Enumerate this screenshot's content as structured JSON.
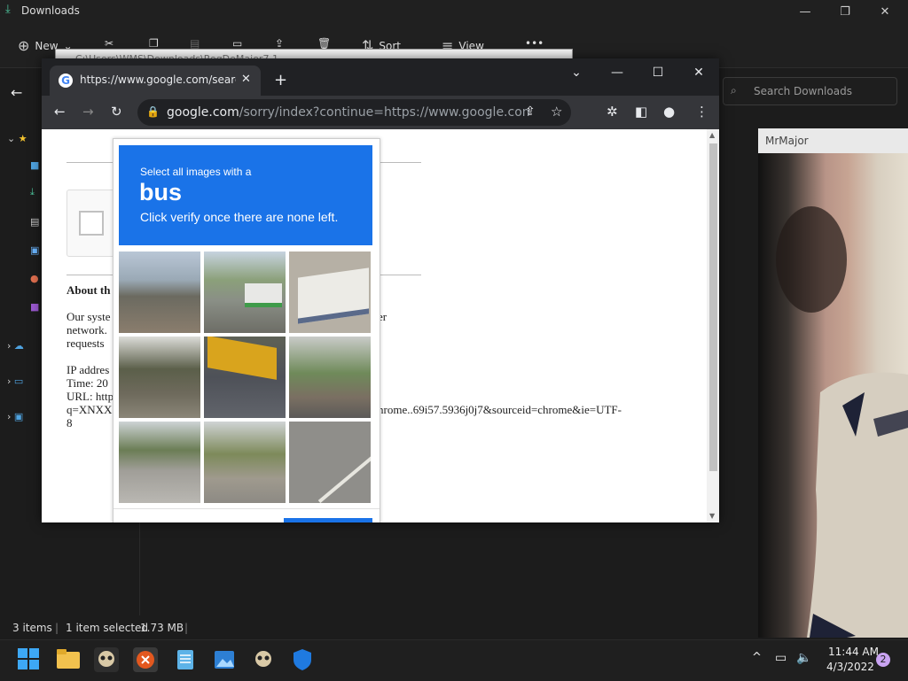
{
  "explorer": {
    "title": "Downloads",
    "toolbar": {
      "new_label": "New",
      "sort_label": "Sort",
      "view_label": "View"
    },
    "search_placeholder": "Search Downloads",
    "status": {
      "items": "3 items",
      "selected": "1 item selected",
      "size": "1.73 MB"
    },
    "ghost_path": "C:\\Users\\WMS\\Downloads\\RegDeMaior7.1"
  },
  "viewer": {
    "title": "MrMajor"
  },
  "chrome": {
    "tab_title": "https://www.google.com/search?",
    "url_host": "google.com",
    "url_rest": "/sorry/index?continue=https://www.google.com/sear...",
    "page": {
      "heading": "About th",
      "para_line1": "Our syste",
      "para_line1_tail": "er",
      "para_line2": "network.",
      "para_line3": "requests",
      "ip_label": "IP addres",
      "time_label": "Time: 20",
      "url_label": "URL: http",
      "q_label": "q=XNXX",
      "q_tail": "hrome..69i57.5936j0j7&sourceid=chrome&ie=UTF-",
      "last_line": "8"
    }
  },
  "captcha": {
    "instruction_top": "Select all images with a",
    "target_word": "bus",
    "instruction_bottom": "Click verify once there are none left."
  },
  "taskbar": {
    "time": "11:44 AM",
    "date": "4/3/2022",
    "notifications": "2"
  }
}
